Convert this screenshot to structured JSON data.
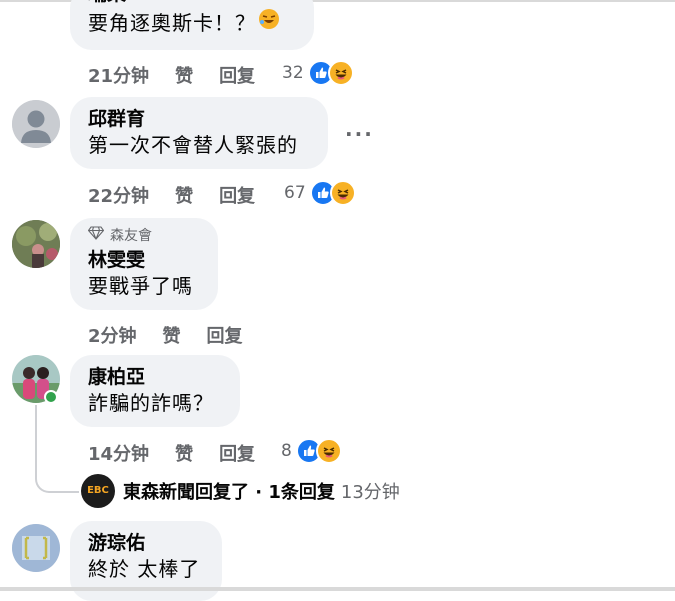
{
  "comments": [
    {
      "author": "瑞某",
      "text": "要角逐奧斯卡！？",
      "time": "21分钟",
      "like_label": "赞",
      "reply_label": "回复",
      "reaction_count": "32"
    },
    {
      "author": "邱群育",
      "text": "第一次不會替人緊張的",
      "time": "22分钟",
      "like_label": "赞",
      "reply_label": "回复",
      "reaction_count": "67"
    },
    {
      "badge": "森友會",
      "author": "林雯雯",
      "text": "要戰爭了嗎",
      "time": "2分钟",
      "like_label": "赞",
      "reply_label": "回复"
    },
    {
      "author": "康柏亞",
      "text": "詐騙的詐嗎？",
      "time": "14分钟",
      "like_label": "赞",
      "reply_label": "回复",
      "reaction_count": "8"
    },
    {
      "author": "游琮佑",
      "text": "終於 太棒了"
    }
  ],
  "reply_summary": {
    "avatar_text": "EBC",
    "name": "東森新聞",
    "action": "回复了 · 1条回复",
    "time": "13分钟"
  },
  "colors": {
    "like_blue": "#1877f2",
    "haha_yellow": "#f7b125",
    "bubble_bg": "#f0f2f5",
    "meta_gray": "#65676b"
  },
  "icons": [
    "more-options-icon",
    "like-reaction-icon",
    "haha-reaction-icon",
    "diamond-badge-icon",
    "emoji-rofl-icon"
  ]
}
